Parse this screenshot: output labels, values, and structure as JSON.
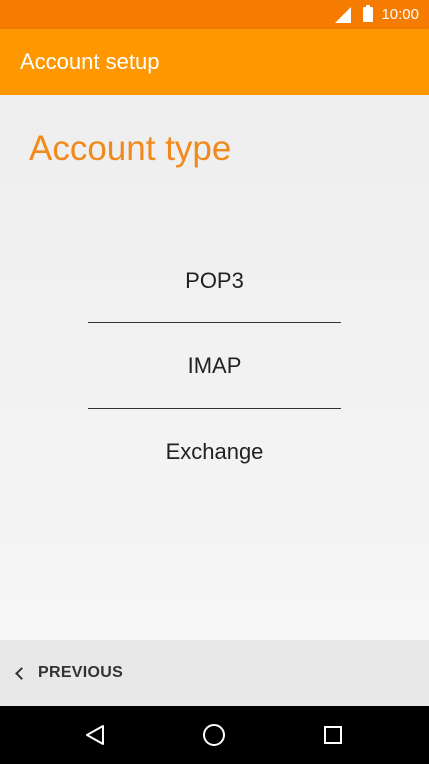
{
  "status_bar": {
    "time": "10:00",
    "icons": [
      "signal-icon",
      "battery-icon"
    ]
  },
  "app_bar": {
    "title": "Account setup"
  },
  "main": {
    "page_title": "Account type",
    "options": [
      {
        "label": "POP3"
      },
      {
        "label": "IMAP"
      },
      {
        "label": "Exchange"
      }
    ]
  },
  "bottom_bar": {
    "previous_label": "PREVIOUS",
    "previous_icon": "chevron-left-icon"
  },
  "nav_bar": {
    "icons": [
      "back-icon",
      "home-icon",
      "recents-icon"
    ]
  },
  "colors": {
    "status_bar": "#f57c00",
    "app_bar": "#ff9800",
    "accent_title": "#f18a1c",
    "background": "#f2f2f2",
    "bottom_bar": "#e8e8e8",
    "nav_bar": "#000000"
  }
}
